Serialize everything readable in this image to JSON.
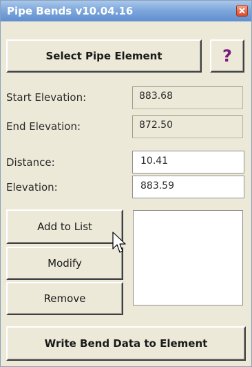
{
  "window": {
    "title": "Pipe Bends v10.04.16",
    "close_label": "close"
  },
  "toolbar": {
    "select_label": "Select Pipe Element",
    "help_label": "?"
  },
  "fields": {
    "start_elevation_label": "Start Elevation:",
    "start_elevation_value": "883.68",
    "end_elevation_label": "End Elevation:",
    "end_elevation_value": "872.50",
    "distance_label": "Distance:",
    "distance_value": "10.41",
    "elevation_label": "Elevation:",
    "elevation_value": "883.59"
  },
  "actions": {
    "add_label": "Add to List",
    "modify_label": "Modify",
    "remove_label": "Remove",
    "write_label": "Write Bend Data to Element"
  },
  "list": {
    "items": []
  },
  "icons": {
    "close": "close-icon",
    "help": "question-mark-icon",
    "cursor": "mouse-pointer-icon"
  },
  "colors": {
    "title_bar": "#7fa8dc",
    "window_bg": "#ece9d8",
    "help_mark": "#7a1a7a",
    "close_button": "#d9472a"
  }
}
